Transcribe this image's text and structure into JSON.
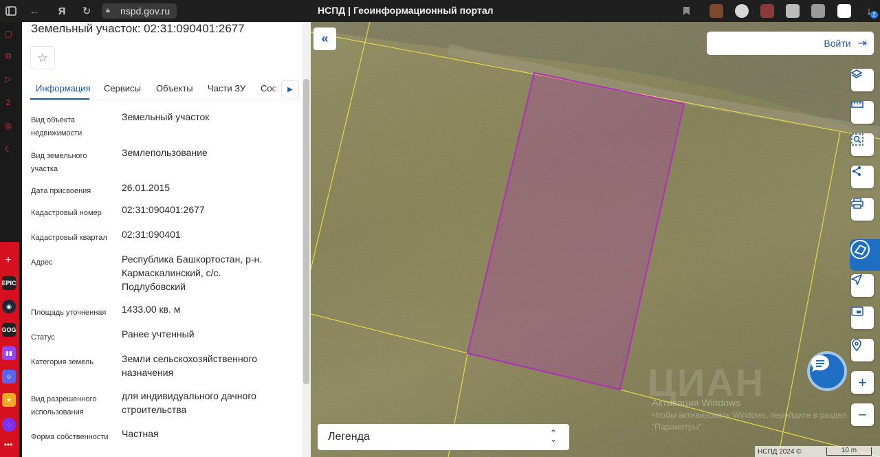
{
  "browser": {
    "url": "nspd.gov.ru",
    "tab_title": "НСПД | Геоинформационный портал",
    "downloads_badge": "2"
  },
  "sidebar_apps": [
    "EPIC GAMES",
    "Steam",
    "GOG.COM",
    "Twitch",
    "Discord"
  ],
  "panel": {
    "title": "Земельный участок: 02:31:090401:2677",
    "tabs": [
      "Информация",
      "Сервисы",
      "Объекты",
      "Части ЗУ",
      "Соста..."
    ],
    "active_tab": "Информация",
    "rows": [
      {
        "label": "Вид объекта недвижимости",
        "value": "Земельный участок"
      },
      {
        "label": "Вид земельного участка",
        "value": "Землепользование"
      },
      {
        "label": "Дата присвоения",
        "value": "26.01.2015"
      },
      {
        "label": "Кадастровый номер",
        "value": "02:31:090401:2677"
      },
      {
        "label": "Кадастровый квартал",
        "value": "02:31:090401"
      },
      {
        "label": "Адрес",
        "value": "Республика Башкортостан, р-н. Кармаскалинский, с/с. Подлубовский"
      },
      {
        "label": "Площадь уточненная",
        "value": "1433.00 кв. м"
      },
      {
        "label": "Статус",
        "value": "Ранее учтенный"
      },
      {
        "label": "Категория земель",
        "value": "Земли сельскохозяйственного назначения"
      },
      {
        "label": "Вид разрешенного использования",
        "value": "для индивидуального дачного строительства"
      },
      {
        "label": "Форма собственности",
        "value": "Частная"
      }
    ]
  },
  "map": {
    "login_label": "Войти",
    "legend_label": "Легенда",
    "watermark_line1": "Активация Windows",
    "watermark_line2": "Чтобы активировать Windows, перейдите в раздел",
    "watermark_line3": "\"Параметры\".",
    "footer_label": "НСПД 2024 ©",
    "scale_label": "10 m",
    "parcel_color": "#b02fb8",
    "boundary_color": "#e6d84a"
  }
}
